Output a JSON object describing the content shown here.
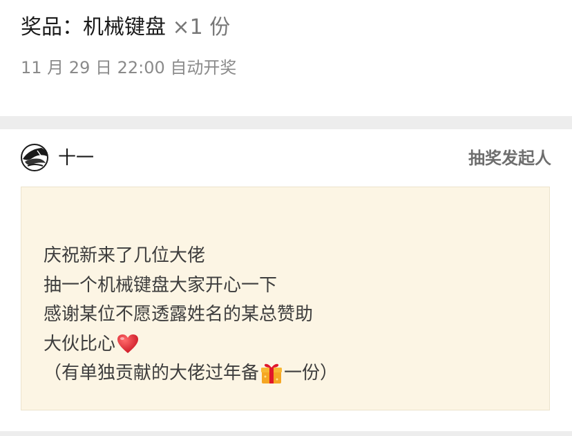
{
  "prize": {
    "title": "奖品：机械键盘",
    "quantity": "×1 份",
    "draw_time": "11 月 29 日 22:00 自动开奖"
  },
  "organizer": {
    "name": "十一",
    "role_label": "抽奖发起人",
    "avatar_icon": "avatar-icon"
  },
  "message": {
    "lines": [
      {
        "text": "庆祝新来了几位大佬"
      },
      {
        "text": "抽一个机械键盘大家开心一下"
      },
      {
        "text": "感谢某位不愿透露姓名的某总赞助"
      },
      {
        "text": "大伙比心",
        "icon": "heart-icon"
      },
      {
        "before": "（有单独贡献的大佬过年备",
        "icon": "gift-icon",
        "after": "一份）"
      }
    ]
  },
  "colors": {
    "card_background": "#fcf5e4",
    "separator": "#ededed",
    "heart": "#e0172b",
    "gift": "#f5a623"
  }
}
